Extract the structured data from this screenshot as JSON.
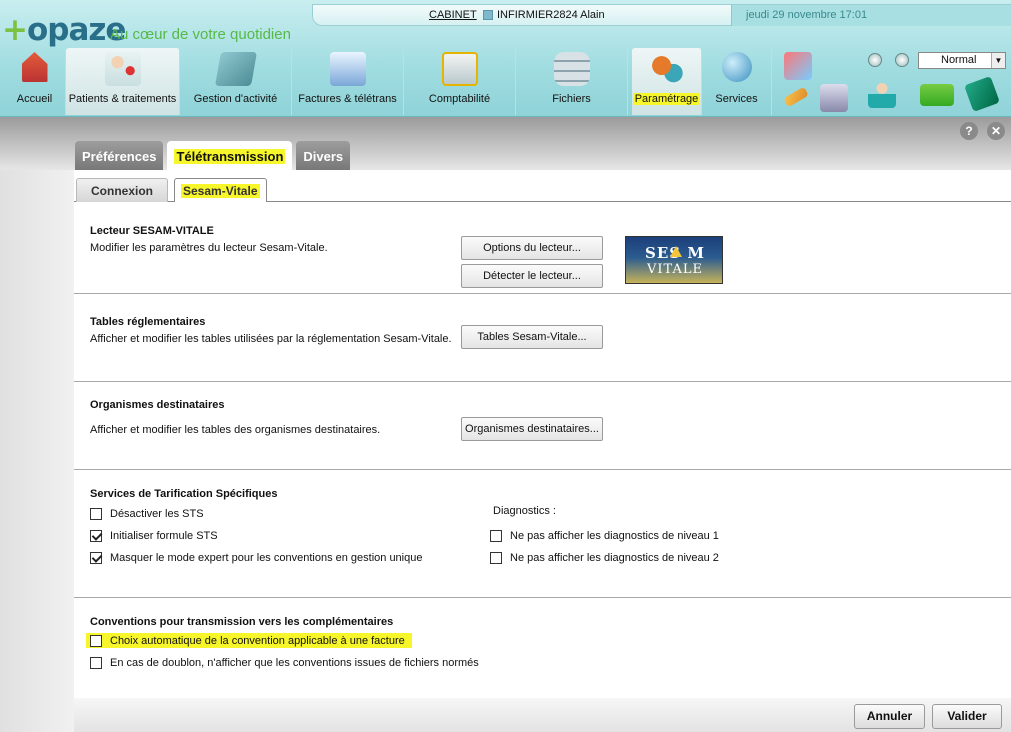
{
  "brand": {
    "name": "opaze",
    "plus": "+",
    "tagline": "Au cœur de votre quotidien"
  },
  "topbar": {
    "cabinet": "CABINET",
    "user": "INFIRMIER2824 Alain",
    "date": "jeudi 29 novembre 17:01"
  },
  "nav": [
    {
      "label": "Accueil",
      "icon": "house-icon"
    },
    {
      "label": "Patients & traitements",
      "icon": "patients-icon",
      "active": true
    },
    {
      "label": "Gestion d'activité",
      "icon": "folder-icon"
    },
    {
      "label": "Factures & télétrans",
      "icon": "invoice-icon"
    },
    {
      "label": "Comptabilité",
      "icon": "calculator-icon"
    },
    {
      "label": "Fichiers",
      "icon": "database-icon"
    },
    {
      "label": "Paramétrage",
      "icon": "gears-icon",
      "highlighted": true
    },
    {
      "label": "Services",
      "icon": "globe-icon"
    }
  ],
  "zoom": {
    "value": "Normal"
  },
  "main_tabs": [
    "Préférences",
    "Télétransmission",
    "Divers"
  ],
  "sub_tabs": [
    "Connexion",
    "Sesam-Vitale"
  ],
  "lecteur": {
    "title": "Lecteur SESAM-VITALE",
    "desc": "Modifier les paramètres du lecteur Sesam-Vitale.",
    "btn_options": "Options du lecteur...",
    "btn_detect": "Détecter le lecteur...",
    "logo_line1": "SES M",
    "logo_line2": "VITALE"
  },
  "tables": {
    "title": "Tables réglementaires",
    "desc": "Afficher et modifier les tables utilisées par la réglementation Sesam-Vitale.",
    "btn": "Tables Sesam-Vitale..."
  },
  "organismes": {
    "title": "Organismes destinataires",
    "desc": "Afficher et modifier les tables des organismes destinataires.",
    "btn": "Organismes destinataires..."
  },
  "sts": {
    "title": "Services de Tarification Spécifiques",
    "diag_label": "Diagnostics :",
    "options": [
      {
        "label": "Désactiver les STS",
        "checked": false
      },
      {
        "label": "Initialiser formule STS",
        "checked": true
      },
      {
        "label": "Masquer le mode expert pour les conventions en gestion unique",
        "checked": true
      }
    ],
    "diag_options": [
      {
        "label": "Ne pas afficher les diagnostics de niveau 1",
        "checked": false
      },
      {
        "label": "Ne pas afficher les diagnostics de niveau 2",
        "checked": false
      }
    ]
  },
  "conventions": {
    "title": "Conventions pour transmission vers les complémentaires",
    "options": [
      {
        "label": "Choix automatique de la convention applicable à une facture",
        "checked": false,
        "highlighted": true
      },
      {
        "label": "En cas de doublon, n'afficher que les conventions issues de fichiers normés",
        "checked": false
      }
    ]
  },
  "footer": {
    "cancel": "Annuler",
    "validate": "Valider"
  },
  "help": {
    "help": "?",
    "close": "✕"
  }
}
